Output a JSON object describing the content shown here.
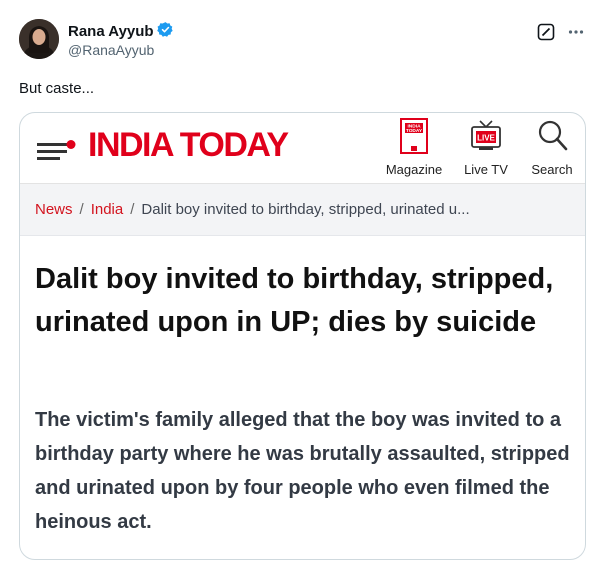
{
  "tweet": {
    "author_name": "Rana Ayyub",
    "handle": "@RanaAyyub",
    "text": "But caste..."
  },
  "icons": {
    "verified": "verified-badge-icon",
    "grok": "grok-icon",
    "more": "more-icon",
    "menu": "hamburger-menu-icon",
    "magazine": "magazine-icon",
    "live_tv": "live-tv-icon",
    "search": "search-icon"
  },
  "colors": {
    "brand_red": "#e0001b",
    "verified_blue": "#1d9bf0",
    "link_red": "#d3141f"
  },
  "card": {
    "logo_text": "INDIA TODAY",
    "nav": [
      {
        "label": "Magazine"
      },
      {
        "label": "Live TV"
      },
      {
        "label": "Search"
      }
    ],
    "magazine_icon_text": [
      "INDIA",
      "TODAY"
    ],
    "live_icon_text": "LIVE",
    "breadcrumb": {
      "news": "News",
      "india": "India",
      "sep": "/",
      "current": "Dalit boy invited to birthday, stripped, urinated u..."
    },
    "headline": "Dalit boy invited to birthday, stripped, urinated upon in UP; dies by suicide",
    "summary": "The victim's family alleged that the boy was invited to a birthday party where he was brutally assaulted, stripped and urinated upon by four people who even filmed the heinous act."
  }
}
